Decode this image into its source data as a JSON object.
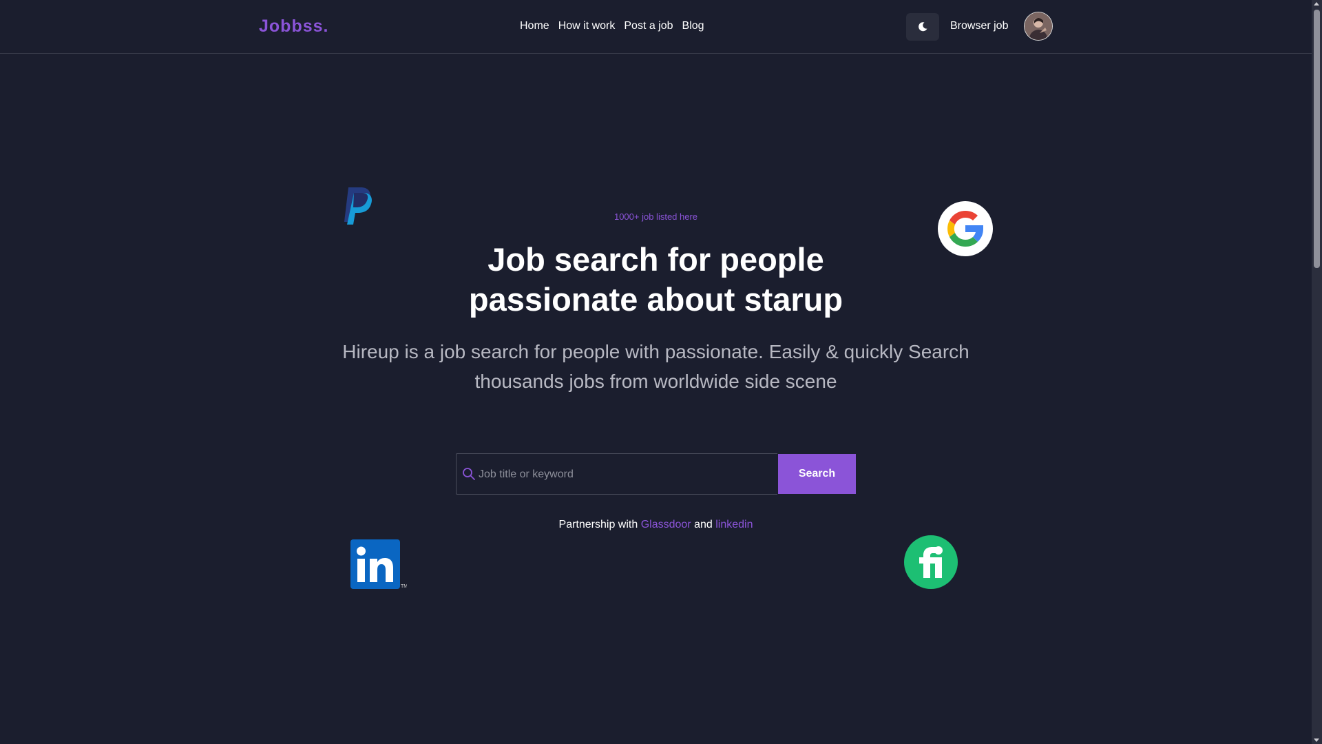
{
  "header": {
    "logo": "Jobbss.",
    "nav": [
      "Home",
      "How it work",
      "Post a job",
      "Blog"
    ],
    "theme_toggle_icon": "moon-icon",
    "browse_label": "Browser job",
    "avatar_icon": "user-avatar"
  },
  "hero": {
    "tagline": "1000+ job listed here",
    "headline_line1": "Job search for people",
    "headline_line2": "passionate about starup",
    "sub_line1": "Hireup is a job search for people with passionate. Easily & quickly Search",
    "sub_line2": "thousands jobs from worldwide side scene"
  },
  "search": {
    "placeholder": "Job title or keyword",
    "button_label": "Search",
    "icon": "search-icon"
  },
  "partnership": {
    "prefix": "Partnership with",
    "partner1": "Glassdoor",
    "joiner": "and",
    "partner2": "linkedin"
  },
  "floating_logos": [
    "paypal-logo",
    "google-logo",
    "linkedin-logo",
    "fiverr-logo"
  ],
  "colors": {
    "background": "#1b1e2e",
    "accent": "#8b54d8",
    "text": "#ffffff",
    "muted": "#b7b8c2"
  }
}
